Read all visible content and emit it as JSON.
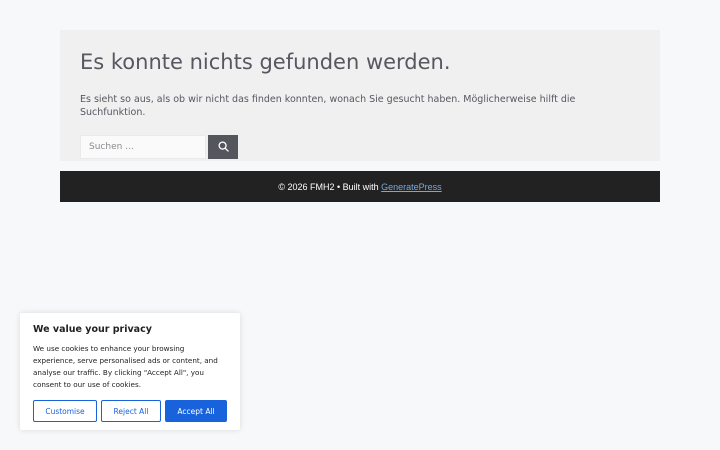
{
  "main": {
    "title": "Es konnte nichts gefunden werden.",
    "text": "Es sieht so aus, als ob wir nicht das finden konnten, wonach Sie gesucht haben. Möglicherweise hilft die Suchfunktion.",
    "search": {
      "placeholder": "Suchen …",
      "value": "",
      "button_icon": "search-icon"
    }
  },
  "footer": {
    "copyright": "© 2026 FMH2",
    "separator": " • Built with ",
    "link_label": "GeneratePress"
  },
  "cookie_banner": {
    "title": "We value your privacy",
    "text": "We use cookies to enhance your browsing experience, serve personalised ads or content, and analyse our traffic. By clicking \"Accept All\", you consent to our use of cookies.",
    "customise_label": "Customise",
    "reject_label": "Reject All",
    "accept_label": "Accept All"
  },
  "colors": {
    "page_bg": "#f7f8f9",
    "content_bg": "#f0f0f0",
    "footer_bg": "#222222",
    "link": "#76a7e2",
    "cookie_accent": "#1863dc"
  }
}
